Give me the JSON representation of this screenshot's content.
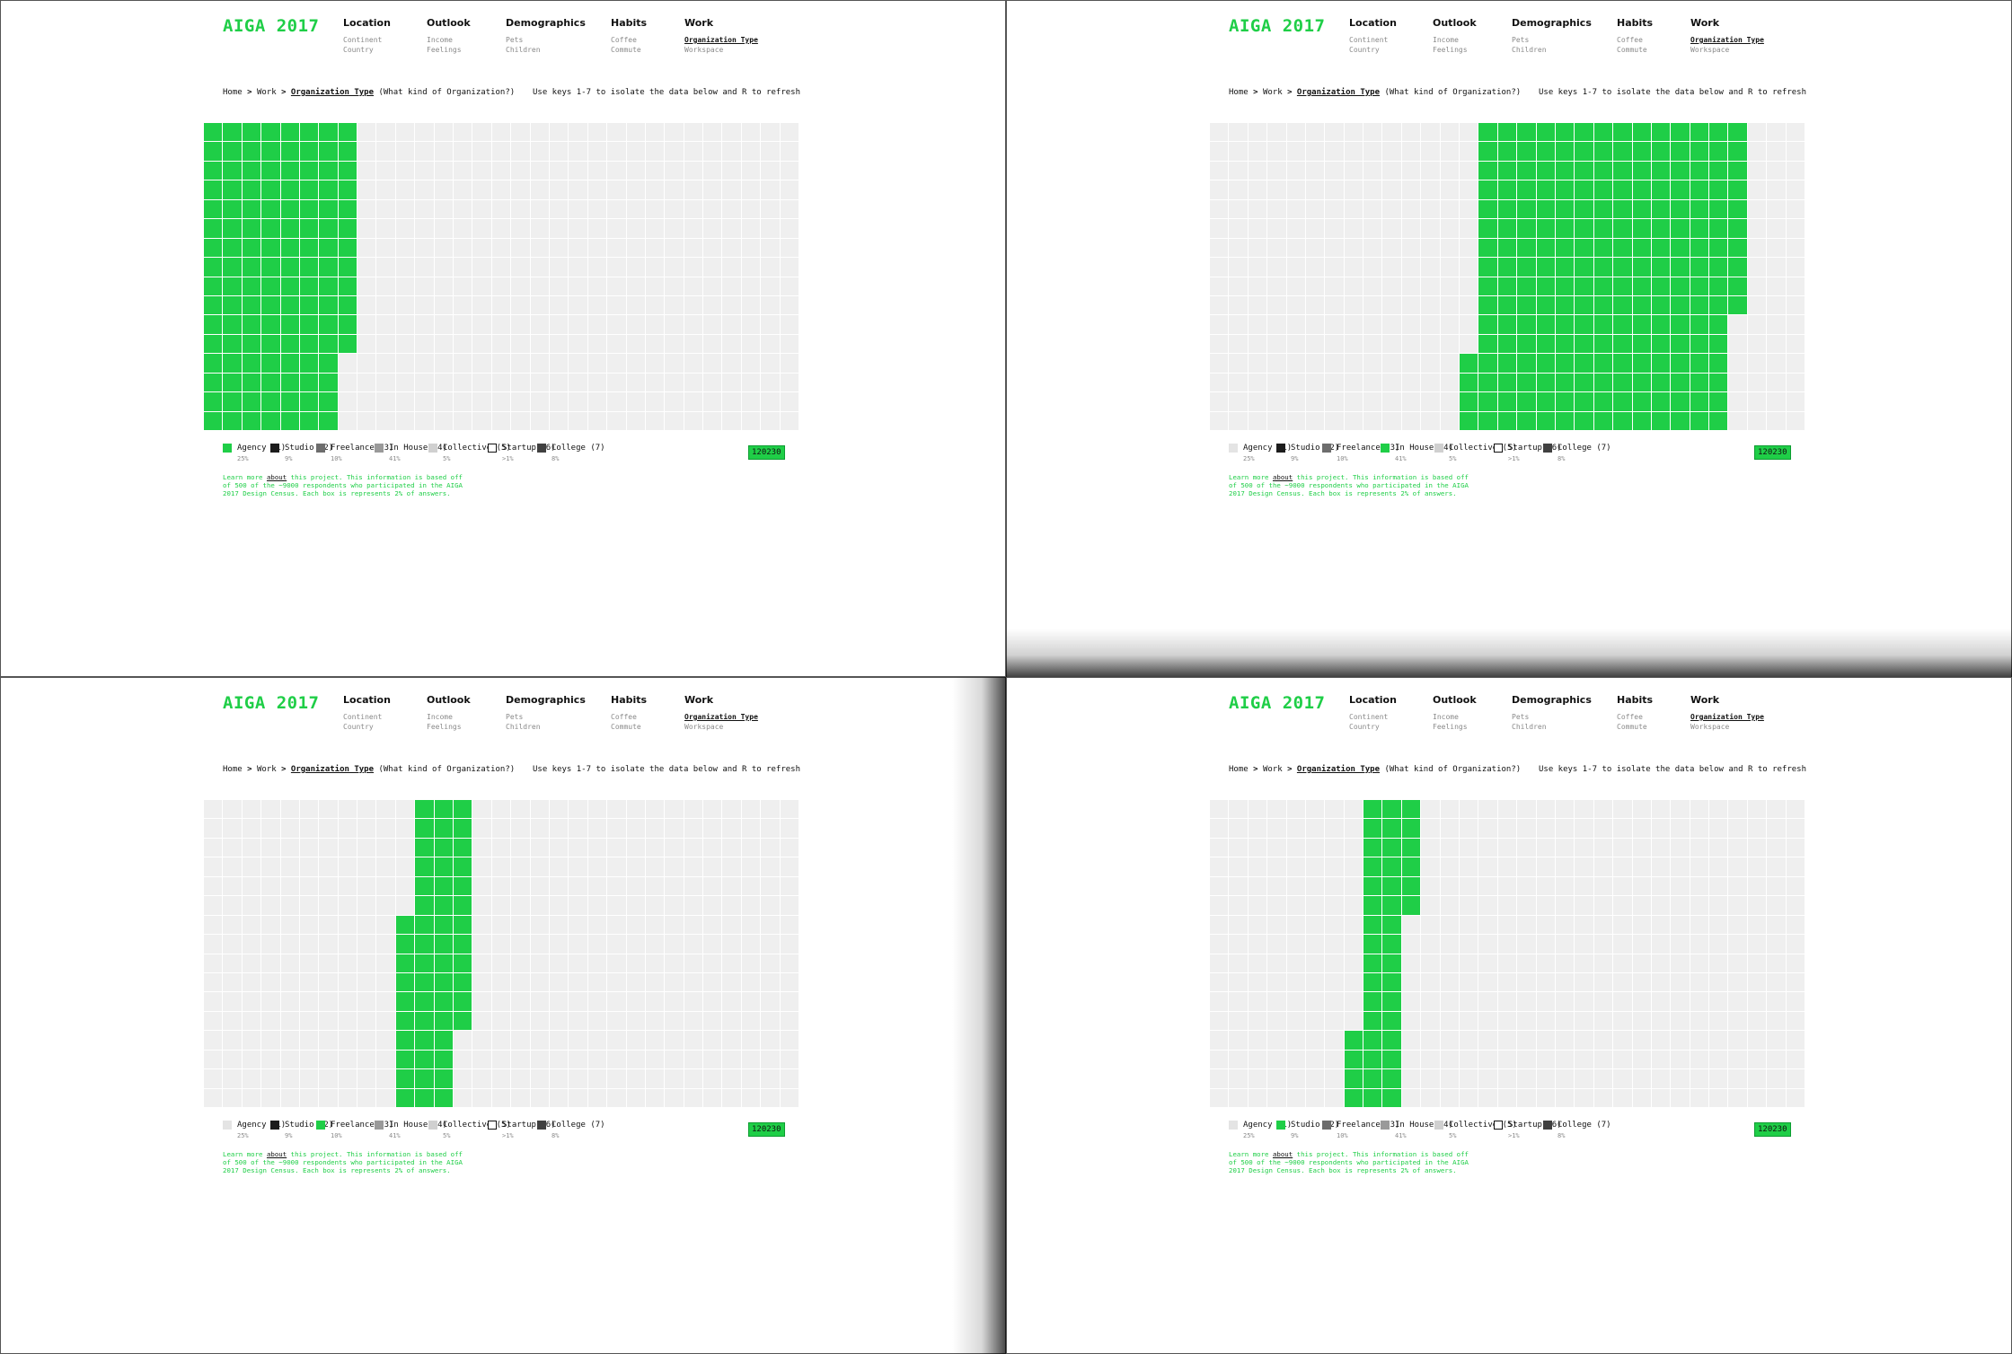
{
  "colors": {
    "accent": "#1fce47",
    "inactive": "#efefef"
  },
  "header": {
    "logo": "AIGA 2017",
    "nav": [
      {
        "label": "Location",
        "items": [
          "Continent",
          "Country"
        ]
      },
      {
        "label": "Outlook",
        "items": [
          "Income",
          "Feelings"
        ]
      },
      {
        "label": "Demographics",
        "items": [
          "Pets",
          "Children"
        ]
      },
      {
        "label": "Habits",
        "items": [
          "Coffee",
          "Commute"
        ]
      },
      {
        "label": "Work",
        "items": [
          "Organization Type",
          "Workspace"
        ]
      }
    ],
    "active_item": "Organization Type"
  },
  "breadcrumb": {
    "home": "Home",
    "sep": ">",
    "section": "Work",
    "current": "Organization Type",
    "question": "(What kind of Organization?)"
  },
  "hint": "Use keys 1-7 to isolate the data below and R to refresh",
  "legend": [
    {
      "label": "Agency (1)",
      "pct": "25%"
    },
    {
      "label": "Studio (2)",
      "pct": "9%"
    },
    {
      "label": "Freelance (3)",
      "pct": "10%"
    },
    {
      "label": "In House (4)",
      "pct": "41%"
    },
    {
      "label": "Collective (5)",
      "pct": "5%"
    },
    {
      "label": "Startup (6)",
      "pct": ">1%"
    },
    {
      "label": "College (7)",
      "pct": "8%"
    }
  ],
  "counter": "120230",
  "note": {
    "before": "Learn more ",
    "link": "about",
    "after": " this project. This information is based off of 500 of the ~9000 respondents who participated in the AIGA 2017 Design Census. Each box is represents 2% of answers."
  },
  "screens": [
    {
      "selected": "Agency (1)"
    },
    {
      "selected": "In House (4)"
    },
    {
      "selected": "Freelance (3)"
    },
    {
      "selected": "Studio (2)"
    }
  ]
}
